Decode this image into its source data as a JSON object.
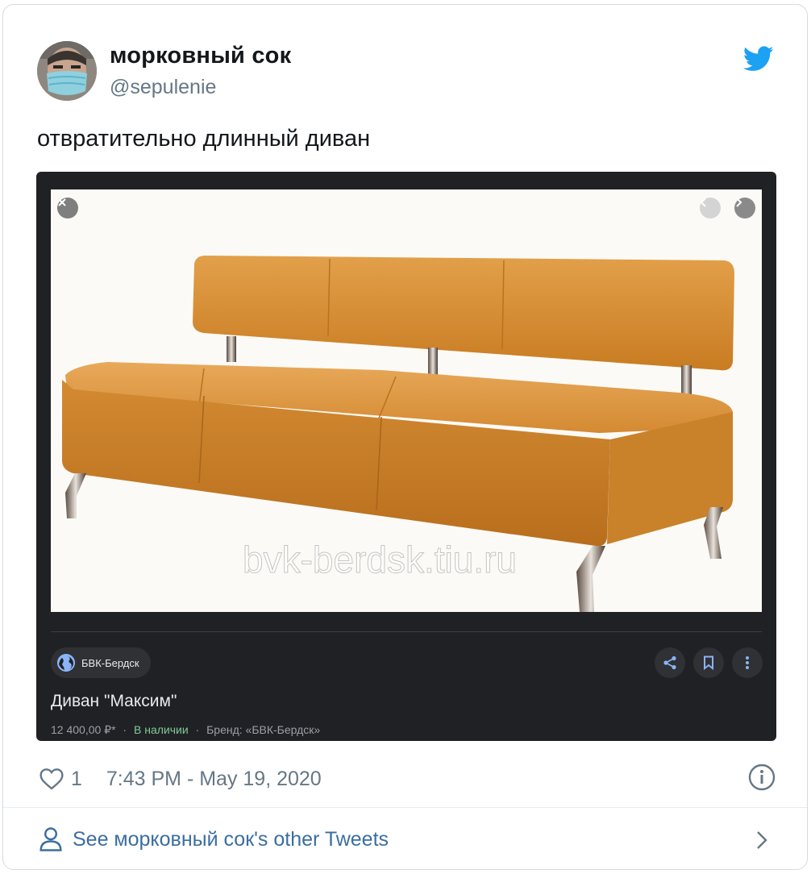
{
  "tweet": {
    "author_name": "морковный сок",
    "author_handle": "@sepulenie",
    "text": "отвратительно длинный диван",
    "like_count": "1",
    "timestamp": "7:43 PM - May 19, 2020"
  },
  "footer": {
    "other_tweets_label": "See морковный сок's other Tweets"
  },
  "media": {
    "watermark": "bvk-berdsk.tiu.ru",
    "source_name": "БВК-Бердск",
    "product_title": "Диван \"Максим\"",
    "price": "12 400,00 ₽*",
    "separator": "·",
    "availability": "В наличии",
    "brand": "Бренд: «БВК-Бердск»"
  },
  "colors": {
    "twitter_blue": "#1da1f2",
    "link_blue": "#3b6ea0",
    "sofa_orange": "#d2862b",
    "dark_panel": "#202124"
  },
  "icons": [
    "twitter-bird-icon",
    "close-icon",
    "chevron-left-icon",
    "chevron-right-icon",
    "globe-icon",
    "share-icon",
    "bookmark-icon",
    "more-vertical-icon",
    "heart-icon",
    "info-icon",
    "user-icon",
    "chevron-right-icon"
  ]
}
